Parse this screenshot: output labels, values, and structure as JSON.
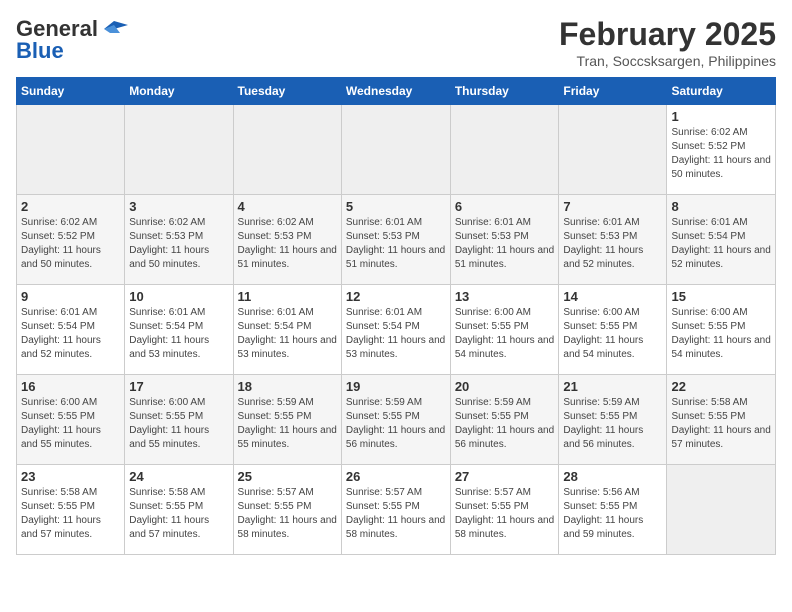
{
  "header": {
    "logo_general": "General",
    "logo_blue": "Blue",
    "month_title": "February 2025",
    "location": "Tran, Soccsksargen, Philippines"
  },
  "calendar": {
    "days_of_week": [
      "Sunday",
      "Monday",
      "Tuesday",
      "Wednesday",
      "Thursday",
      "Friday",
      "Saturday"
    ],
    "weeks": [
      [
        {
          "day": "",
          "info": ""
        },
        {
          "day": "",
          "info": ""
        },
        {
          "day": "",
          "info": ""
        },
        {
          "day": "",
          "info": ""
        },
        {
          "day": "",
          "info": ""
        },
        {
          "day": "",
          "info": ""
        },
        {
          "day": "1",
          "info": "Sunrise: 6:02 AM\nSunset: 5:52 PM\nDaylight: 11 hours and 50 minutes."
        }
      ],
      [
        {
          "day": "2",
          "info": "Sunrise: 6:02 AM\nSunset: 5:52 PM\nDaylight: 11 hours and 50 minutes."
        },
        {
          "day": "3",
          "info": "Sunrise: 6:02 AM\nSunset: 5:53 PM\nDaylight: 11 hours and 50 minutes."
        },
        {
          "day": "4",
          "info": "Sunrise: 6:02 AM\nSunset: 5:53 PM\nDaylight: 11 hours and 51 minutes."
        },
        {
          "day": "5",
          "info": "Sunrise: 6:01 AM\nSunset: 5:53 PM\nDaylight: 11 hours and 51 minutes."
        },
        {
          "day": "6",
          "info": "Sunrise: 6:01 AM\nSunset: 5:53 PM\nDaylight: 11 hours and 51 minutes."
        },
        {
          "day": "7",
          "info": "Sunrise: 6:01 AM\nSunset: 5:53 PM\nDaylight: 11 hours and 52 minutes."
        },
        {
          "day": "8",
          "info": "Sunrise: 6:01 AM\nSunset: 5:54 PM\nDaylight: 11 hours and 52 minutes."
        }
      ],
      [
        {
          "day": "9",
          "info": "Sunrise: 6:01 AM\nSunset: 5:54 PM\nDaylight: 11 hours and 52 minutes."
        },
        {
          "day": "10",
          "info": "Sunrise: 6:01 AM\nSunset: 5:54 PM\nDaylight: 11 hours and 53 minutes."
        },
        {
          "day": "11",
          "info": "Sunrise: 6:01 AM\nSunset: 5:54 PM\nDaylight: 11 hours and 53 minutes."
        },
        {
          "day": "12",
          "info": "Sunrise: 6:01 AM\nSunset: 5:54 PM\nDaylight: 11 hours and 53 minutes."
        },
        {
          "day": "13",
          "info": "Sunrise: 6:00 AM\nSunset: 5:55 PM\nDaylight: 11 hours and 54 minutes."
        },
        {
          "day": "14",
          "info": "Sunrise: 6:00 AM\nSunset: 5:55 PM\nDaylight: 11 hours and 54 minutes."
        },
        {
          "day": "15",
          "info": "Sunrise: 6:00 AM\nSunset: 5:55 PM\nDaylight: 11 hours and 54 minutes."
        }
      ],
      [
        {
          "day": "16",
          "info": "Sunrise: 6:00 AM\nSunset: 5:55 PM\nDaylight: 11 hours and 55 minutes."
        },
        {
          "day": "17",
          "info": "Sunrise: 6:00 AM\nSunset: 5:55 PM\nDaylight: 11 hours and 55 minutes."
        },
        {
          "day": "18",
          "info": "Sunrise: 5:59 AM\nSunset: 5:55 PM\nDaylight: 11 hours and 55 minutes."
        },
        {
          "day": "19",
          "info": "Sunrise: 5:59 AM\nSunset: 5:55 PM\nDaylight: 11 hours and 56 minutes."
        },
        {
          "day": "20",
          "info": "Sunrise: 5:59 AM\nSunset: 5:55 PM\nDaylight: 11 hours and 56 minutes."
        },
        {
          "day": "21",
          "info": "Sunrise: 5:59 AM\nSunset: 5:55 PM\nDaylight: 11 hours and 56 minutes."
        },
        {
          "day": "22",
          "info": "Sunrise: 5:58 AM\nSunset: 5:55 PM\nDaylight: 11 hours and 57 minutes."
        }
      ],
      [
        {
          "day": "23",
          "info": "Sunrise: 5:58 AM\nSunset: 5:55 PM\nDaylight: 11 hours and 57 minutes."
        },
        {
          "day": "24",
          "info": "Sunrise: 5:58 AM\nSunset: 5:55 PM\nDaylight: 11 hours and 57 minutes."
        },
        {
          "day": "25",
          "info": "Sunrise: 5:57 AM\nSunset: 5:55 PM\nDaylight: 11 hours and 58 minutes."
        },
        {
          "day": "26",
          "info": "Sunrise: 5:57 AM\nSunset: 5:55 PM\nDaylight: 11 hours and 58 minutes."
        },
        {
          "day": "27",
          "info": "Sunrise: 5:57 AM\nSunset: 5:55 PM\nDaylight: 11 hours and 58 minutes."
        },
        {
          "day": "28",
          "info": "Sunrise: 5:56 AM\nSunset: 5:55 PM\nDaylight: 11 hours and 59 minutes."
        },
        {
          "day": "",
          "info": ""
        }
      ]
    ]
  }
}
